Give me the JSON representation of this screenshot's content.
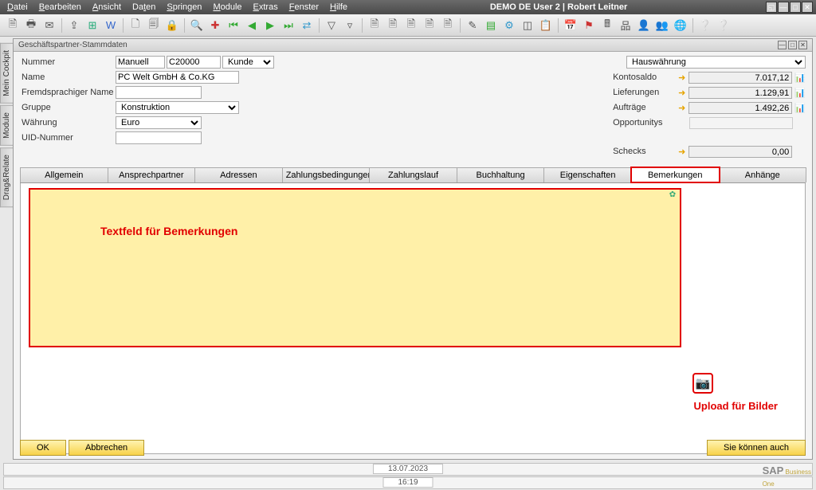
{
  "window": {
    "title": "DEMO DE User 2 | Robert Leitner",
    "menus": [
      "Datei",
      "Bearbeiten",
      "Ansicht",
      "Daten",
      "Springen",
      "Module",
      "Extras",
      "Fenster",
      "Hilfe"
    ]
  },
  "sidetabs": [
    "Mein Cockpit",
    "Module",
    "Drag&Relate"
  ],
  "form": {
    "title": "Geschäftspartner-Stammdaten",
    "fields": {
      "nummer_label": "Nummer",
      "manuell": "Manuell",
      "bpcode": "C20000",
      "kind": "Kunde",
      "name_label": "Name",
      "name": "PC Welt GmbH & Co.KG",
      "fremd_label": "Fremdsprachiger Name",
      "fremd": "",
      "gruppe_label": "Gruppe",
      "gruppe": "Konstruktion",
      "waehrung_label": "Währung",
      "waehrung": "Euro",
      "uid_label": "UID-Nummer",
      "uid": ""
    },
    "right": {
      "hauswaehrung": "Hauswährung",
      "kontosaldo_label": "Kontosaldo",
      "kontosaldo": "7.017,12",
      "lieferungen_label": "Lieferungen",
      "lieferungen": "1.129,91",
      "auftraege_label": "Aufträge",
      "auftraege": "1.492,26",
      "opportunitys_label": "Opportunitys",
      "opportunitys": "",
      "schecks_label": "Schecks",
      "schecks": "0,00"
    },
    "tabs": [
      "Allgemein",
      "Ansprechpartner",
      "Adressen",
      "Zahlungsbedingungen",
      "Zahlungslauf",
      "Buchhaltung",
      "Eigenschaften",
      "Bemerkungen",
      "Anhänge"
    ],
    "active_tab": 7,
    "annotations": {
      "remarks": "Textfeld für Bemerkungen",
      "upload": "Upload für Bilder"
    },
    "buttons": {
      "ok": "OK",
      "cancel": "Abbrechen",
      "youcan": "Sie können auch"
    }
  },
  "status": {
    "date": "13.07.2023",
    "time": "16:19"
  },
  "brand": {
    "sap": "SAP",
    "bo": "Business",
    "one": "One"
  }
}
